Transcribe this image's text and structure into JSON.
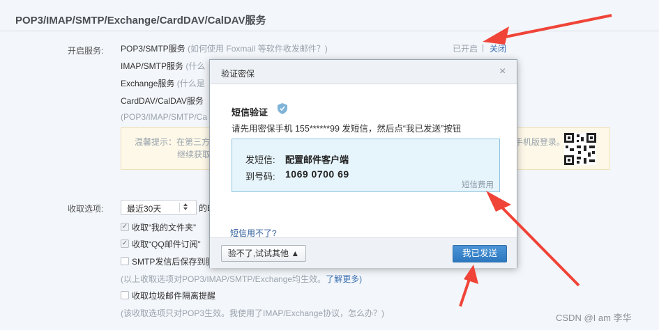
{
  "page": {
    "title": "POP3/IMAP/SMTP/Exchange/CardDAV/CalDAV服务",
    "enable_label": "开启服务:",
    "services": [
      {
        "name": "POP3/SMTP服务",
        "hint": "(如何使用 Foxmail 等软件收发邮件？)",
        "status": "已开启",
        "sep": "|",
        "action": "关闭"
      },
      {
        "name": "IMAP/SMTP服务",
        "hint": "(什么"
      },
      {
        "name": "Exchange服务",
        "hint": "(什么是"
      },
      {
        "name": "CardDAV/CalDAV服务",
        "hint": ""
      }
    ],
    "partial_note": "(POP3/IMAP/SMTP/Ca",
    "tip": {
      "prefix": "温馨提示：在第三方",
      "line2": "继续获取",
      "right": "手机版登录。"
    },
    "receive_label": "收取选项:",
    "select_value": "最近30天",
    "select_after": "的B",
    "options": [
      {
        "label": "收取“我的文件夹”",
        "checked": true
      },
      {
        "label": "收取“QQ邮件订阅”",
        "checked": true
      },
      {
        "label": "SMTP发信后保存到服",
        "checked": false
      }
    ],
    "receive_note": "(以上收取选项对POP3/IMAP/SMTP/Exchange均生效。",
    "learn_more": "了解更多)",
    "junk_label": "收取垃圾邮件隔离提醒",
    "pop3_note": "(该收取选项只对POP3生效。我使用了IMAP/Exchange协议，怎么办？)"
  },
  "dialog": {
    "title": "验证密保",
    "close": "×",
    "sms_title": "短信验证",
    "sms_desc": "请先用密保手机 155******99 发短信，然后点“我已发送”按钮",
    "send_key": "发短信:",
    "send_value": "配置邮件客户端",
    "to_key": "到号码:",
    "to_value": "1069 0700 69",
    "fee_link": "短信费用",
    "help_link": "短信用不了?",
    "btn_other": "验不了,试试其他 ▲",
    "btn_sent": "我已发送"
  },
  "watermark": "CSDN @I am 李华",
  "colors": {
    "arrow": "#f04438",
    "primary_button": "#2c78c0",
    "sms_box_bg": "#e6f4fb"
  }
}
